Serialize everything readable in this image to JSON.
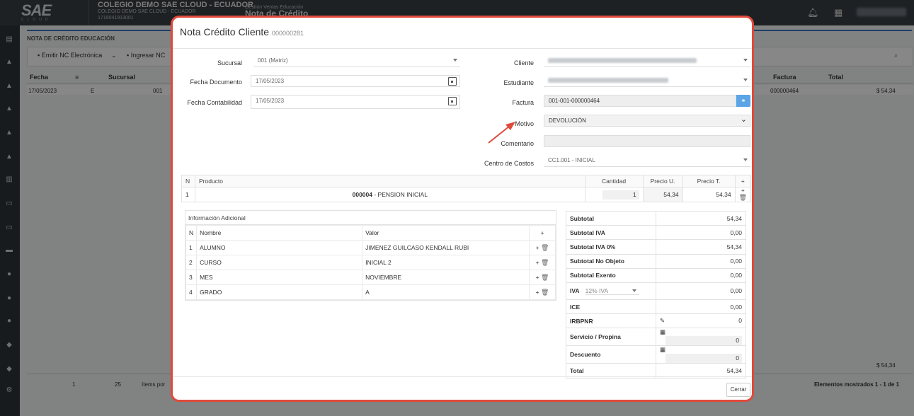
{
  "app": {
    "logo_text": "SAE",
    "logo_sub": "CLOUD",
    "org_name": "COLEGIO DEMO SAE CLOUD - ECUADOR",
    "org_sub": "COLEGIO DEMO SAE CLOUD - ECUADOR",
    "org_ruc": "1719041913001",
    "module_sub": "Gestión Ventas Educación",
    "module_title": "Nota de Crédito"
  },
  "page": {
    "title": "NOTA DE CRÉDITO EDUCACIÓN",
    "toolbar": {
      "emit_label": "Emitir NC Electrónica",
      "ingresar_label": "Ingresar NC"
    },
    "grid": {
      "headers": {
        "fecha": "Fecha",
        "sucursal": "Sucursal",
        "factura": "Factura",
        "total": "Total"
      },
      "row": {
        "fecha": "17/05/2023",
        "e": "E",
        "sucursal": "001",
        "factura": "000000464",
        "total": "$ 54,34"
      }
    },
    "footer_total": "$ 54,34",
    "pager": {
      "page": "1",
      "page_size": "25",
      "items_label": "ítems por",
      "shown": "Elementos mostrados 1 - 1 de 1"
    }
  },
  "modal": {
    "title": "Nota Crédito Cliente",
    "number": "000000281",
    "form": {
      "sucursal_label": "Sucursal",
      "sucursal_value": "001 (Matriz)",
      "fecha_doc_label": "Fecha Documento",
      "fecha_doc_value": "17/05/2023",
      "fecha_cont_label": "Fecha Contabilidad",
      "fecha_cont_value": "17/05/2023",
      "cliente_label": "Cliente",
      "estudiante_label": "Estudiante",
      "factura_label": "Factura",
      "factura_value": "001-001-000000464",
      "motivo_label": "Motivo",
      "motivo_value": "DEVOLUCIÓN",
      "comentario_label": "Comentario",
      "comentario_value": "",
      "centro_label": "Centro de Costos",
      "centro_value": "CC1.001 - INICIAL"
    },
    "products": {
      "headers": {
        "n": "N",
        "producto": "Producto",
        "cantidad": "Cantidad",
        "precio_u": "Precio U.",
        "precio_t": "Precio T.",
        "add": "+"
      },
      "rows": [
        {
          "n": "1",
          "code": "000004",
          "name": " - PENSION INICIAL",
          "cantidad": "1",
          "precio_u": "54,34",
          "precio_t": "54,34"
        }
      ]
    },
    "info": {
      "title": "Información Adicional",
      "headers": {
        "n": "N",
        "nombre": "Nombre",
        "valor": "Valor",
        "add": "+"
      },
      "rows": [
        {
          "n": "1",
          "nombre": "ALUMNO",
          "valor": "JIMENEZ GUILCASO KENDALL RUBI"
        },
        {
          "n": "2",
          "nombre": "CURSO",
          "valor": "INICIAL 2"
        },
        {
          "n": "3",
          "nombre": "MES",
          "valor": "NOVIEMBRE"
        },
        {
          "n": "4",
          "nombre": "GRADO",
          "valor": "A"
        }
      ]
    },
    "totals": {
      "subtotal": {
        "label": "Subtotal",
        "value": "54,34"
      },
      "subtotal_iva": {
        "label": "Subtotal IVA",
        "value": "0,00"
      },
      "subtotal_iva0": {
        "label": "Subtotal IVA 0%",
        "value": "54,34"
      },
      "subtotal_no_objeto": {
        "label": "Subtotal No Objeto",
        "value": "0,00"
      },
      "subtotal_exento": {
        "label": "Subtotal Exento",
        "value": "0,00"
      },
      "iva": {
        "label": "IVA",
        "option": "12% IVA",
        "value": "0,00"
      },
      "ice": {
        "label": "ICE",
        "value": "0,00"
      },
      "irbpnr": {
        "label": "IRBPNR",
        "value": "0"
      },
      "servicio": {
        "label": "Servicio / Propina",
        "value": "0"
      },
      "descuento": {
        "label": "Descuento",
        "value": "0"
      },
      "total": {
        "label": "Total",
        "value": "54,34"
      }
    },
    "close_label": "Cerrar"
  },
  "colors": {
    "accent": "#3b78c4",
    "highlight_border": "#e04a3b",
    "link_button": "#5ba4e6"
  }
}
